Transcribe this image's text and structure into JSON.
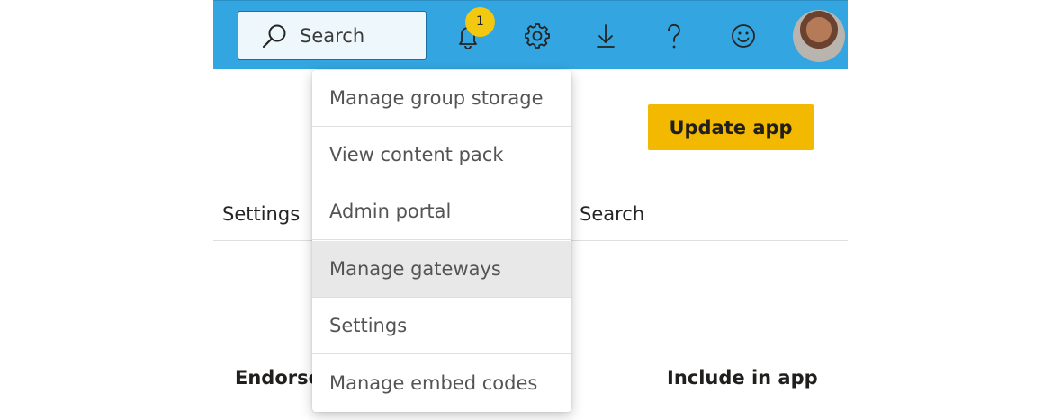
{
  "header": {
    "search_placeholder": "Search",
    "notification_count": "1",
    "icons": [
      "search-icon",
      "bell-icon",
      "gear-icon",
      "download-icon",
      "help-icon",
      "smiley-feedback-icon",
      "user-avatar"
    ]
  },
  "page": {
    "update_app_label": "Update app",
    "tab_settings_label": "Settings",
    "tab_search_label": "Search",
    "col_endorsement_label": "Endorser",
    "col_include_label": "Include in app"
  },
  "settings_menu": {
    "items": [
      {
        "label": "Manage group storage"
      },
      {
        "label": "View content pack"
      },
      {
        "label": "Admin portal"
      },
      {
        "label": "Manage gateways",
        "hovered": true
      },
      {
        "label": "Settings"
      },
      {
        "label": "Manage embed codes"
      }
    ]
  },
  "colors": {
    "topbar": "#33a5e0",
    "update_button": "#f2b900",
    "badge": "#f2c811",
    "hover_row": "#e8e8e8"
  }
}
